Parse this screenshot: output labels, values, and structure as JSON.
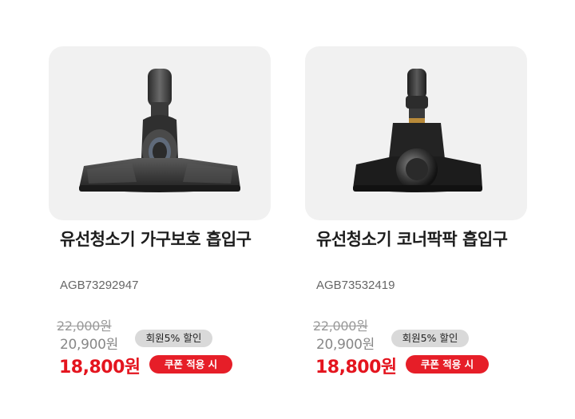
{
  "products": [
    {
      "title": "유선청소기 가구보호 흡입구",
      "model": "AGB73292947",
      "original_price": "22,000원",
      "member_price": "20,900원",
      "member_badge": "회원5% 할인",
      "final_price": "18,800원",
      "coupon_badge": "쿠폰 적용 시",
      "image_icon": "furniture-brush-nozzle"
    },
    {
      "title": "유선청소기 코너팍팍 흡입구",
      "model": "AGB73532419",
      "original_price": "22,000원",
      "member_price": "20,900원",
      "member_badge": "회원5% 할인",
      "final_price": "18,800원",
      "coupon_badge": "쿠폰 적용 시",
      "image_icon": "corner-nozzle"
    }
  ],
  "colors": {
    "price_red": "#e4141e",
    "coupon_bg": "#e61e28",
    "member_badge_bg": "#d9d9d9",
    "thumb_bg": "#f1f1f1"
  }
}
